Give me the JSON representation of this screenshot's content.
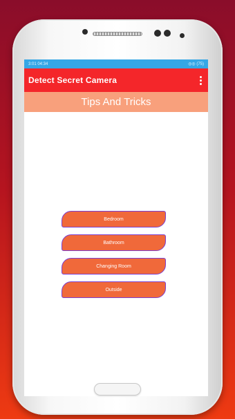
{
  "status_bar": {
    "time": "3:01 04:34",
    "icons": "◎◎ (75)"
  },
  "app_bar": {
    "title": "Detect Secret Camera",
    "menu_icon": "more-vert-icon"
  },
  "banner": {
    "text": "Tips And Tricks"
  },
  "rooms": [
    {
      "label": "Bedroom"
    },
    {
      "label": "Bathroom"
    },
    {
      "label": "Changing Room"
    },
    {
      "label": "Outside"
    }
  ],
  "colors": {
    "status": "#35a7e6",
    "app_bar": "#f4262a",
    "banner": "#f8a07c",
    "button": "#f0693a",
    "button_border": "#7a3fd2"
  }
}
